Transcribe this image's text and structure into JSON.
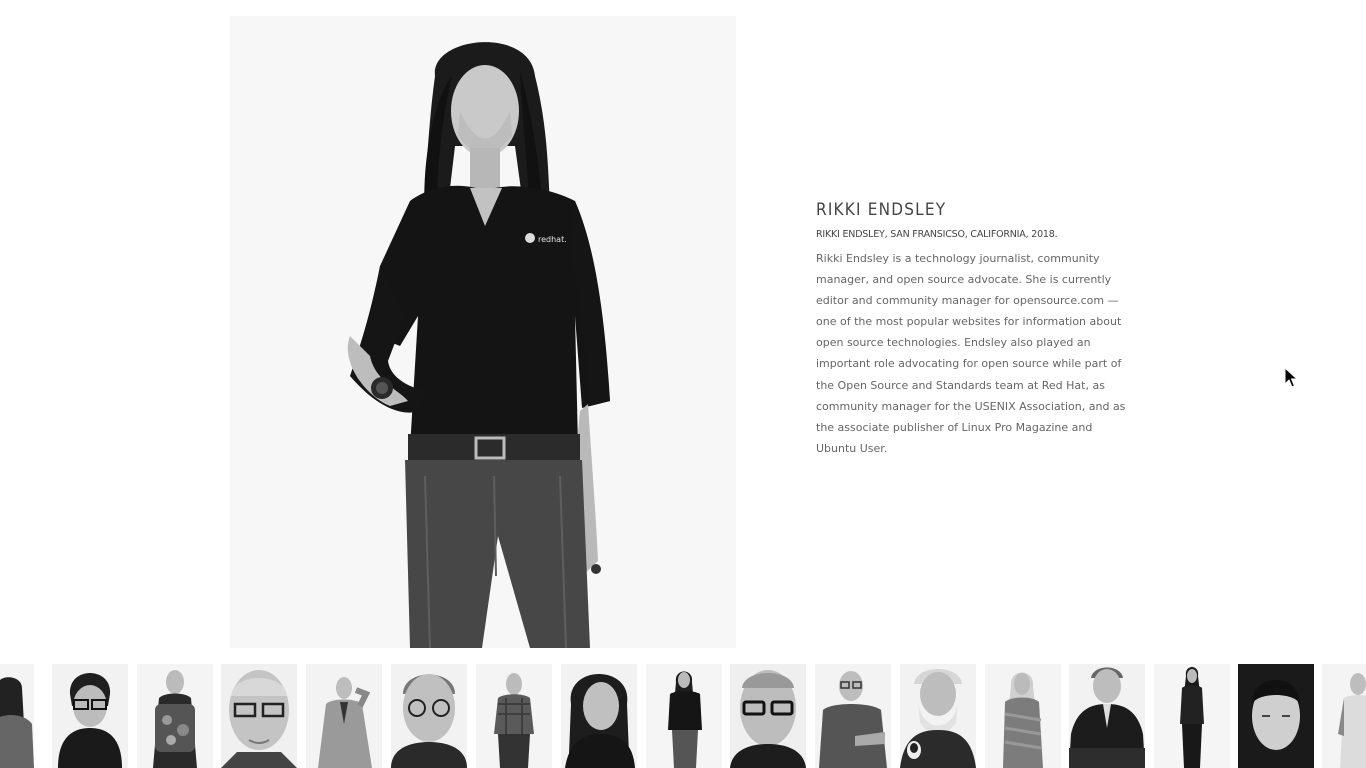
{
  "profile": {
    "name": "RIKKI ENDSLEY",
    "caption": "RIKKI ENDSLEY, SAN FRANSICSO, CALIFORNIA, 2018.",
    "bio": "Rikki Endsley is a technology journalist, community manager, and open source advocate. She is currently editor and community manager for opensource.com — one of the most popular websites for information about open source technologies. Endsley also played an important role advocating for open source while part of the Open Source and Standards team at Red Hat, as community manager for the USENIX Association, and as the associate publisher of Linux Pro Magazine and Ubuntu User.",
    "shirt_logo": "redhat."
  },
  "thumbnails": [
    {
      "id": "thumb-1"
    },
    {
      "id": "thumb-2"
    },
    {
      "id": "thumb-3"
    },
    {
      "id": "thumb-4"
    },
    {
      "id": "thumb-5"
    },
    {
      "id": "thumb-6"
    },
    {
      "id": "thumb-7"
    },
    {
      "id": "thumb-8"
    },
    {
      "id": "thumb-9"
    },
    {
      "id": "thumb-10"
    },
    {
      "id": "thumb-11"
    },
    {
      "id": "thumb-12"
    },
    {
      "id": "thumb-13"
    },
    {
      "id": "thumb-14"
    },
    {
      "id": "thumb-15"
    },
    {
      "id": "thumb-16"
    },
    {
      "id": "thumb-17"
    }
  ],
  "colors": {
    "background": "#ffffff",
    "text": "#666666",
    "heading": "#444444"
  }
}
